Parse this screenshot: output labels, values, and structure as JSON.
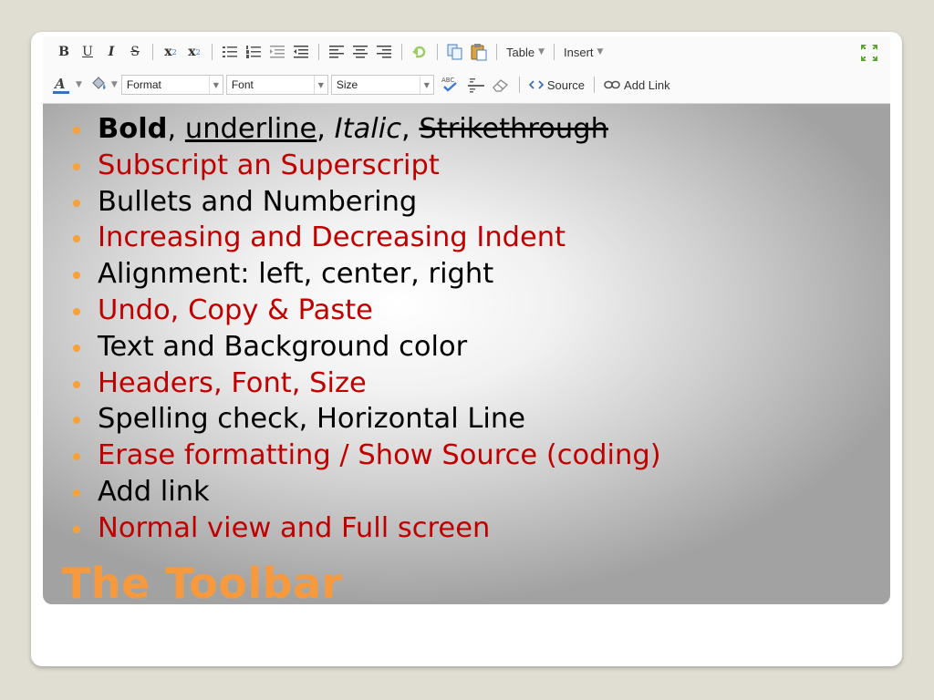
{
  "toolbar": {
    "row1": {
      "bold": "B",
      "underline": "U",
      "italic": "I",
      "strike": "S",
      "subscript": "x",
      "subscript_sub": "2",
      "superscript": "x",
      "superscript_sup": "2",
      "table_label": "Table",
      "insert_label": "Insert"
    },
    "row2": {
      "format_label": "Format",
      "font_label": "Font",
      "size_label": "Size",
      "spell_label": "ABC",
      "source_label": "Source",
      "addlink_label": "Add Link"
    },
    "dropdown_glyph": "▼"
  },
  "bullets": [
    {
      "parts": [
        {
          "text": "Bold",
          "style": "bold"
        },
        {
          "text": ", ",
          "style": "plain"
        },
        {
          "text": "underline",
          "style": "underline"
        },
        {
          "text": ", ",
          "style": "plain"
        },
        {
          "text": "Italic",
          "style": "italic"
        },
        {
          "text": ", ",
          "style": "plain"
        },
        {
          "text": "Strikethrough",
          "style": "strike"
        }
      ],
      "color": "black"
    },
    {
      "text": "Subscript an Superscript",
      "color": "red"
    },
    {
      "text": "Bullets and Numbering",
      "color": "black"
    },
    {
      "text": "Increasing and Decreasing Indent",
      "color": "red"
    },
    {
      "text": "Alignment: left, center, right",
      "color": "black"
    },
    {
      "text": "Undo, Copy & Paste",
      "color": "red"
    },
    {
      "text": "Text and Background color",
      "color": "black"
    },
    {
      "text": "Headers, Font, Size",
      "color": "red"
    },
    {
      "text": "Spelling check, Horizontal Line",
      "color": "black"
    },
    {
      "text": "Erase formatting / Show Source (coding)",
      "color": "red"
    },
    {
      "text": "Add link",
      "color": "black"
    },
    {
      "text": "Normal view and Full screen",
      "color": "red"
    }
  ],
  "slide": {
    "title": "The Toolbar"
  },
  "colors": {
    "accent": "#f79a3d",
    "bullet": "#f7a13a",
    "red_text": "#c00000",
    "background": "#e0ddd2"
  }
}
